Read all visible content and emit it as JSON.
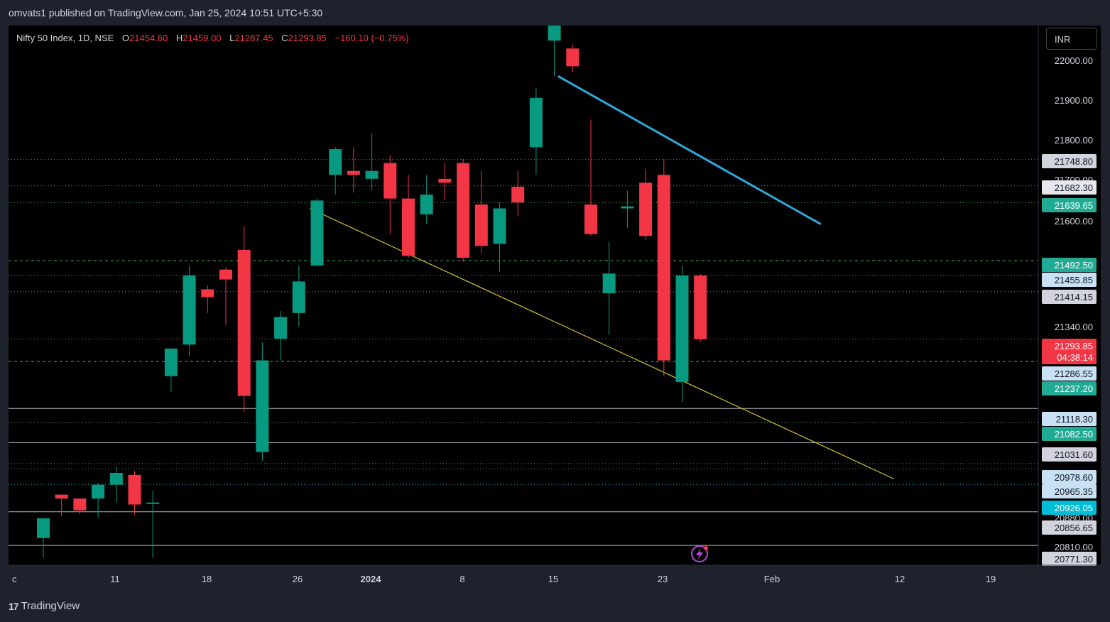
{
  "header": {
    "published": "omvats1 published on TradingView.com, Jan 25, 2024 10:51 UTC+5:30"
  },
  "symbol": {
    "name": "Nifty 50 Index, 1D, NSE",
    "open_label": "O",
    "open": "21454.60",
    "high_label": "H",
    "high": "21459.00",
    "low_label": "L",
    "low": "21287.45",
    "close_label": "C",
    "close": "21293.85",
    "change": "−160.10 (−0.75%)"
  },
  "currency_button": "INR",
  "footer": {
    "brand": "TradingView",
    "logo_text": "17"
  },
  "colors": {
    "up": "#089981",
    "down": "#f23645",
    "trendline_upper": "#2fa8d8",
    "trendline_lower": "#d4c32a",
    "background": "#000000"
  },
  "chart_data": {
    "type": "candlestick",
    "interval": "1D",
    "ylim": [
      20771.3,
      22090
    ],
    "x_ticks": [
      "c",
      "11",
      "18",
      "26",
      "2024",
      "8",
      "15",
      "23",
      "Feb",
      "12",
      "19"
    ],
    "y_ticks": [
      "22000.00",
      "21900.00",
      "21800.00",
      "21700.00",
      "21600.00",
      "21340.00",
      "20880.00",
      "20810.00"
    ],
    "candles": [
      {
        "o": 20790,
        "h": 20810,
        "l": 20740,
        "c": 20840
      },
      {
        "o": 20900,
        "h": 20895,
        "l": 20845,
        "c": 20890
      },
      {
        "o": 20890,
        "h": 20890,
        "l": 20850,
        "c": 20860
      },
      {
        "o": 20890,
        "h": 20930,
        "l": 20840,
        "c": 20925
      },
      {
        "o": 20925,
        "h": 20970,
        "l": 20880,
        "c": 20955
      },
      {
        "o": 20950,
        "h": 20960,
        "l": 20850,
        "c": 20875
      },
      {
        "o": 20880,
        "h": 20910,
        "l": 20740,
        "c": 20880
      },
      {
        "o": 21200,
        "h": 21270,
        "l": 21160,
        "c": 21270
      },
      {
        "o": 21280,
        "h": 21480,
        "l": 21250,
        "c": 21455
      },
      {
        "o": 21420,
        "h": 21430,
        "l": 21360,
        "c": 21400
      },
      {
        "o": 21470,
        "h": 21475,
        "l": 21330,
        "c": 21445
      },
      {
        "o": 21520,
        "h": 21580,
        "l": 21110,
        "c": 21150
      },
      {
        "o": 21008,
        "h": 21285,
        "l": 20985,
        "c": 21240
      },
      {
        "o": 21295,
        "h": 21365,
        "l": 21240,
        "c": 21350
      },
      {
        "o": 21360,
        "h": 21480,
        "l": 21325,
        "c": 21440
      },
      {
        "o": 21480,
        "h": 21650,
        "l": 21480,
        "c": 21645
      },
      {
        "o": 21710,
        "h": 21780,
        "l": 21660,
        "c": 21775
      },
      {
        "o": 21720,
        "h": 21780,
        "l": 21665,
        "c": 21710
      },
      {
        "o": 21700,
        "h": 21815,
        "l": 21670,
        "c": 21720
      },
      {
        "o": 21740,
        "h": 21760,
        "l": 21560,
        "c": 21650
      },
      {
        "o": 21650,
        "h": 21710,
        "l": 21500,
        "c": 21505
      },
      {
        "o": 21610,
        "h": 21710,
        "l": 21585,
        "c": 21660
      },
      {
        "o": 21700,
        "h": 21740,
        "l": 21645,
        "c": 21690
      },
      {
        "o": 21740,
        "h": 21750,
        "l": 21490,
        "c": 21500
      },
      {
        "o": 21635,
        "h": 21720,
        "l": 21510,
        "c": 21530
      },
      {
        "o": 21535,
        "h": 21640,
        "l": 21465,
        "c": 21625
      },
      {
        "o": 21680,
        "h": 21720,
        "l": 21605,
        "c": 21640
      },
      {
        "o": 21780,
        "h": 21930,
        "l": 21710,
        "c": 21905
      },
      {
        "o": 22050,
        "h": 22120,
        "l": 21960,
        "c": 22095
      },
      {
        "o": 22030,
        "h": 22040,
        "l": 21970,
        "c": 21985
      },
      {
        "o": 21635,
        "h": 21850,
        "l": 21555,
        "c": 21560
      },
      {
        "o": 21410,
        "h": 21540,
        "l": 21305,
        "c": 21460
      },
      {
        "o": 21625,
        "h": 21670,
        "l": 21575,
        "c": 21630
      },
      {
        "o": 21690,
        "h": 21725,
        "l": 21545,
        "c": 21555
      },
      {
        "o": 21710,
        "h": 21750,
        "l": 21200,
        "c": 21240
      },
      {
        "o": 21185,
        "h": 21480,
        "l": 21135,
        "c": 21455
      },
      {
        "o": 21455,
        "h": 21459,
        "l": 21287.45,
        "c": 21293.85
      }
    ],
    "price_labels": [
      {
        "value": 21748.8,
        "text": "21748.80",
        "style": "gray",
        "line": "dotted"
      },
      {
        "value": 21682.3,
        "text": "21682.30",
        "style": "light",
        "line": "dotted"
      },
      {
        "value": 21639.65,
        "text": "21639.65",
        "style": "green",
        "line": "dotted-green"
      },
      {
        "value": 21492.5,
        "text": "21492.50",
        "style": "green",
        "line": "dashed-green"
      },
      {
        "value": 21455.85,
        "text": "21455.85",
        "style": "lightblue",
        "line": "dotted"
      },
      {
        "value": 21414.15,
        "text": "21414.15",
        "style": "gray",
        "line": "dotted"
      },
      {
        "value": 21293.85,
        "text": "21293.85",
        "style": "red",
        "line": "dotted-red",
        "sub": "04:38:14"
      },
      {
        "value": 21237.2,
        "text": "21286.55",
        "style": "lightblue",
        "line": "dashed-green"
      },
      {
        "value": 21200.0,
        "text": "21237.20",
        "style": "green",
        "line": "none"
      },
      {
        "value": 21118.3,
        "text": "21118.30",
        "style": "lightblue",
        "line": "solid"
      },
      {
        "value": 21082.5,
        "text": "21082.50",
        "style": "green",
        "line": "dotted-green"
      },
      {
        "value": 21031.6,
        "text": "21031.60",
        "style": "gray",
        "line": "solid"
      },
      {
        "value": 20978.6,
        "text": "20978.60",
        "style": "lightblue",
        "line": "dotted"
      },
      {
        "value": 20965.35,
        "text": "20965.35",
        "style": "lightblue",
        "line": "dotted"
      },
      {
        "value": 20926.05,
        "text": "20926.05",
        "style": "cyan",
        "line": "dotted-cyan"
      },
      {
        "value": 20856.65,
        "text": "20856.65",
        "style": "gray",
        "line": "solid"
      },
      {
        "value": 20771.3,
        "text": "20771.30",
        "style": "gray",
        "line": "solid"
      }
    ],
    "trendlines": [
      {
        "name": "upper",
        "color": "#2fa8d8",
        "from": {
          "bar": 28.2,
          "price": 21960
        },
        "to": {
          "bar": 42.6,
          "price": 21585
        }
      },
      {
        "name": "lower",
        "color": "#d4c32a",
        "from": {
          "bar": 14.6,
          "price": 21625
        },
        "to": {
          "bar": 46.6,
          "price": 20940
        }
      }
    ]
  }
}
